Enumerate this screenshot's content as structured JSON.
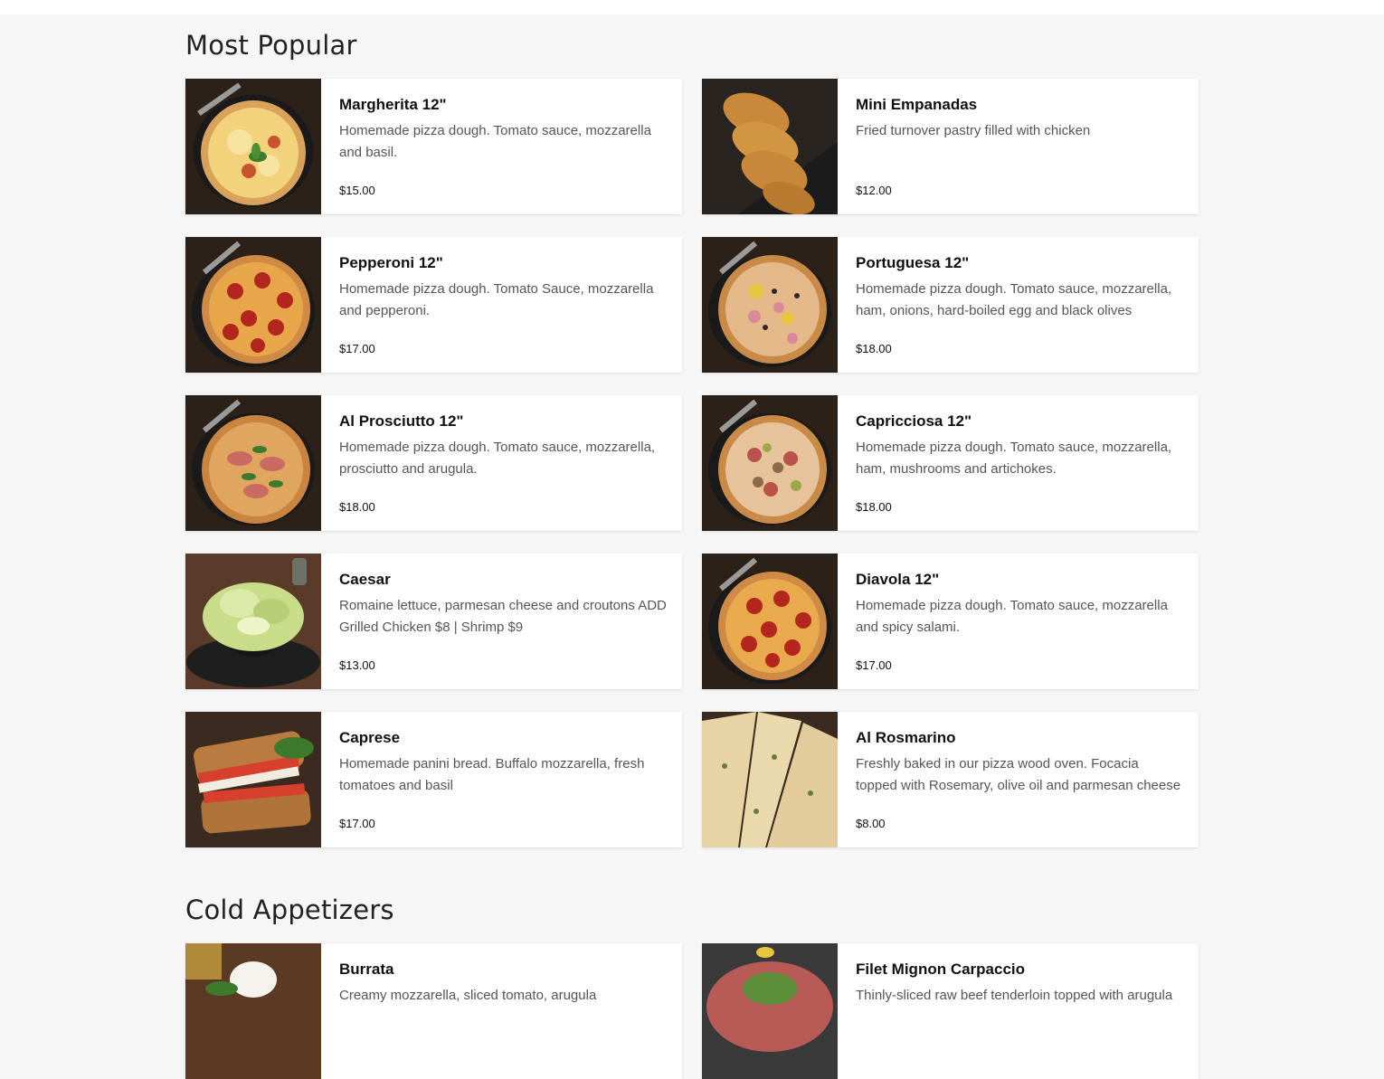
{
  "sections": [
    {
      "title": "Most Popular",
      "items": [
        {
          "name": "Margherita 12\"",
          "description": "Homemade pizza dough. Tomato sauce, mozzarella and basil.",
          "price": "$15.00",
          "image_icon": "pizza-margherita-icon"
        },
        {
          "name": "Mini Empanadas",
          "description": "Fried turnover pastry filled with chicken",
          "price": "$12.00",
          "image_icon": "empanadas-icon"
        },
        {
          "name": "Pepperoni 12\"",
          "description": "Homemade pizza dough. Tomato Sauce, mozzarella and pepperoni.",
          "price": "$17.00",
          "image_icon": "pizza-pepperoni-icon"
        },
        {
          "name": "Portuguesa 12\"",
          "description": "Homemade pizza dough. Tomato sauce, mozzarella, ham, onions, hard-boiled egg and black olives",
          "price": "$18.00",
          "image_icon": "pizza-portuguesa-icon"
        },
        {
          "name": "Al Prosciutto 12\"",
          "description": "Homemade pizza dough. Tomato sauce, mozzarella, prosciutto and arugula.",
          "price": "$18.00",
          "image_icon": "pizza-prosciutto-icon"
        },
        {
          "name": "Capricciosa 12\"",
          "description": "Homemade pizza dough. Tomato sauce, mozzarella, ham, mushrooms and artichokes.",
          "price": "$18.00",
          "image_icon": "pizza-capricciosa-icon"
        },
        {
          "name": "Caesar",
          "description": "Romaine lettuce, parmesan cheese and croutons ADD Grilled Chicken $8 | Shrimp $9",
          "price": "$13.00",
          "image_icon": "salad-icon"
        },
        {
          "name": "Diavola 12\"",
          "description": "Homemade pizza dough. Tomato sauce, mozzarella and spicy salami.",
          "price": "$17.00",
          "image_icon": "pizza-diavola-icon"
        },
        {
          "name": "Caprese",
          "description": "Homemade panini bread. Buffalo mozzarella, fresh tomatoes and basil",
          "price": "$17.00",
          "image_icon": "panini-icon"
        },
        {
          "name": "Al Rosmarino",
          "description": "Freshly baked in our pizza wood oven. Focacia topped with Rosemary, olive oil and parmesan cheese",
          "price": "$8.00",
          "image_icon": "focaccia-icon"
        }
      ]
    },
    {
      "title": "Cold Appetizers",
      "items": [
        {
          "name": "Burrata",
          "description": "Creamy mozzarella, sliced tomato, arugula",
          "price": "",
          "image_icon": "burrata-icon"
        },
        {
          "name": "Filet Mignon Carpaccio",
          "description": "Thinly-sliced raw beef tenderloin topped with arugula",
          "price": "",
          "image_icon": "carpaccio-icon"
        }
      ]
    }
  ]
}
